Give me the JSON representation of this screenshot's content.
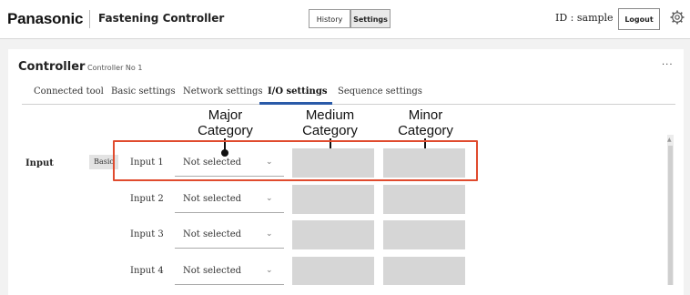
{
  "header": {
    "brand": "Panasonic",
    "app_title": "Fastening Controller",
    "history_label": "History",
    "settings_label": "Settings",
    "user_id": "ID : sample",
    "logout_label": "Logout"
  },
  "controller": {
    "title": "Controller",
    "subtitle": "Controller No 1",
    "more": "···"
  },
  "tabs": [
    {
      "label": "Connected tool"
    },
    {
      "label": "Basic settings"
    },
    {
      "label": "Network settings"
    },
    {
      "label": "I/O settings",
      "active": true
    },
    {
      "label": "Sequence settings"
    }
  ],
  "annotations": {
    "major": "Major\nCategory",
    "medium": "Medium\nCategory",
    "minor": "Minor\nCategory"
  },
  "io": {
    "section_label": "Input",
    "basic_tag": "Basic",
    "rows": [
      {
        "label": "Input 1",
        "value": "Not selected"
      },
      {
        "label": "Input 2",
        "value": "Not selected"
      },
      {
        "label": "Input 3",
        "value": "Not selected"
      },
      {
        "label": "Input 4",
        "value": "Not selected"
      }
    ]
  },
  "colors": {
    "highlight": "#e04b2e",
    "tab_active": "#2a5aa8",
    "category_box": "#d6d6d6"
  }
}
